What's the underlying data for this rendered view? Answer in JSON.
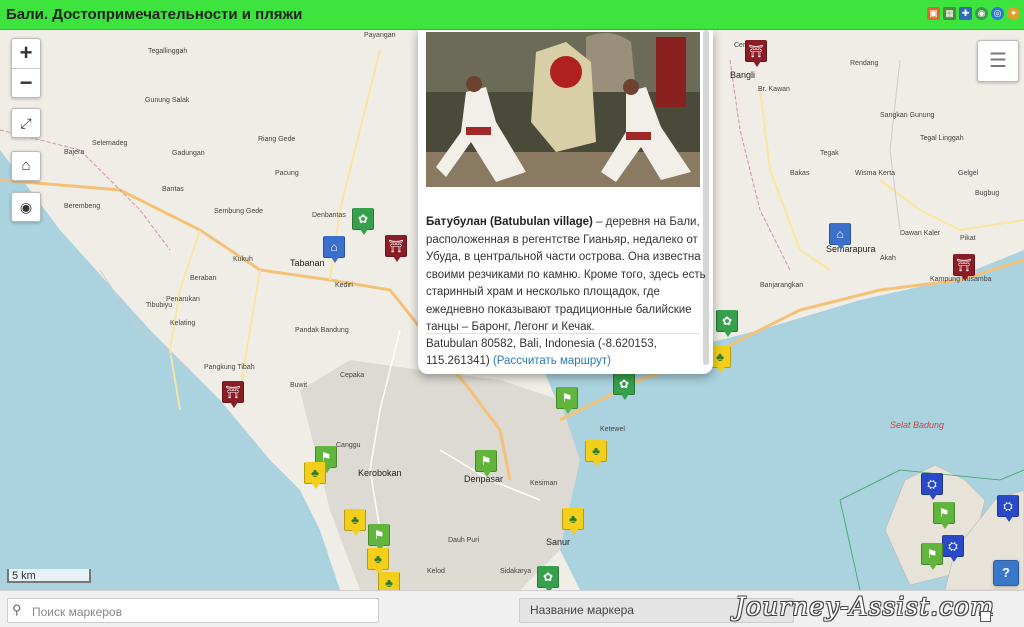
{
  "header": {
    "title": "Бали. Достопримечательности и пляжи",
    "icons": [
      "map-icon",
      "grid-icon",
      "puzzle-icon",
      "globe-icon",
      "earth-icon",
      "settings-icon"
    ]
  },
  "map": {
    "controls": {
      "zoom_in": "+",
      "zoom_out": "−",
      "fullscreen_icon": "fullscreen-icon",
      "home_icon": "home-icon",
      "locate_icon": "locate-icon",
      "layers_icon": "layers-icon",
      "help": "?"
    },
    "scale": "5 km",
    "sea_label": "Selat Badung",
    "places": {
      "denpasar": "Denpasar",
      "tabanan": "Tabanan",
      "semarapura": "Semarapura",
      "bangli": "Bangli",
      "kerobokan": "Kerobokan",
      "sanur": "Sanur",
      "payangan": "Payangan",
      "bantas": "Bantas",
      "gadungan": "Gadungan",
      "pacung": "Pacung",
      "tegallinggah": "Tegallinggah",
      "gunung_salak": "Gunung Salak",
      "riang_gede": "Riang Gede",
      "selemadeg": "Selemadeg",
      "bajera": "Bajera",
      "berembeng": "Berembeng",
      "sembung_gede": "Sembung Gede",
      "denbantas": "Denbantas",
      "kukuh": "Kukuh",
      "beraban": "Beraban",
      "kediri": "Kediri",
      "tibubiyu": "Tibubiyu",
      "penarukan": "Penarukan",
      "kelating": "Kelating",
      "pangkung_tibah": "Pangkung Tibah",
      "pandak_bandung": "Pandak Bandung",
      "cepaka": "Cepaka",
      "buwit": "Buwit",
      "canggu": "Canggu",
      "kelod": "Kelod",
      "sidakarya": "Sidakarya",
      "dauh_puri": "Dauh Puri",
      "tegak": "Tegak",
      "bakas": "Bakas",
      "akah": "Akah",
      "pikat": "Pikat",
      "cempaga": "Cempaga",
      "br_kawan": "Br. Kawan",
      "sangkan_gunung": "Sangkan Gunung",
      "bugbug": "Bugbug",
      "kampung_kusamba": "Kampung Kusamba",
      "banjarangkan": "Banjarangkan",
      "kesiman": "Kesiman",
      "ketewel": "Ketewel",
      "rendang": "Rendang",
      "gelgel": "Gelgel",
      "wisma_kerta": "Wisma Kerta",
      "tegal_linggah": "Tegal Linggah",
      "dawan_kaler": "Dawan Kaler"
    },
    "markers": [
      {
        "type": "temple",
        "icon": "temple-icon"
      },
      {
        "type": "flag",
        "icon": "flag-icon"
      },
      {
        "type": "beach",
        "icon": "palm-icon"
      },
      {
        "type": "palace",
        "icon": "palace-icon"
      },
      {
        "type": "garden",
        "icon": "flower-icon"
      },
      {
        "type": "dive",
        "icon": "diver-icon"
      }
    ]
  },
  "popup": {
    "title": "Батубулан (Batubulan village)",
    "description": " – деревня на Бали, расположенная в регентстве Гианьяр, недалеко от Убуда, в центральной части острова. Она известна своими резчиками по камню. Кроме того, здесь есть старинный храм и несколько площадок, где ежедневно показывают традиционные балийские танцы – Баронг, Легонг и Кечак.",
    "address": "Batubulan 80582, Bali, Indonesia (-8.620153, 115.261341) ",
    "route_link": "(Рассчитать маршрут)"
  },
  "footer": {
    "search_placeholder": "Поиск маркеров",
    "search_icon": "search-icon",
    "marker_select": "Название маркера",
    "watermark": "Journey-Assist.com"
  }
}
